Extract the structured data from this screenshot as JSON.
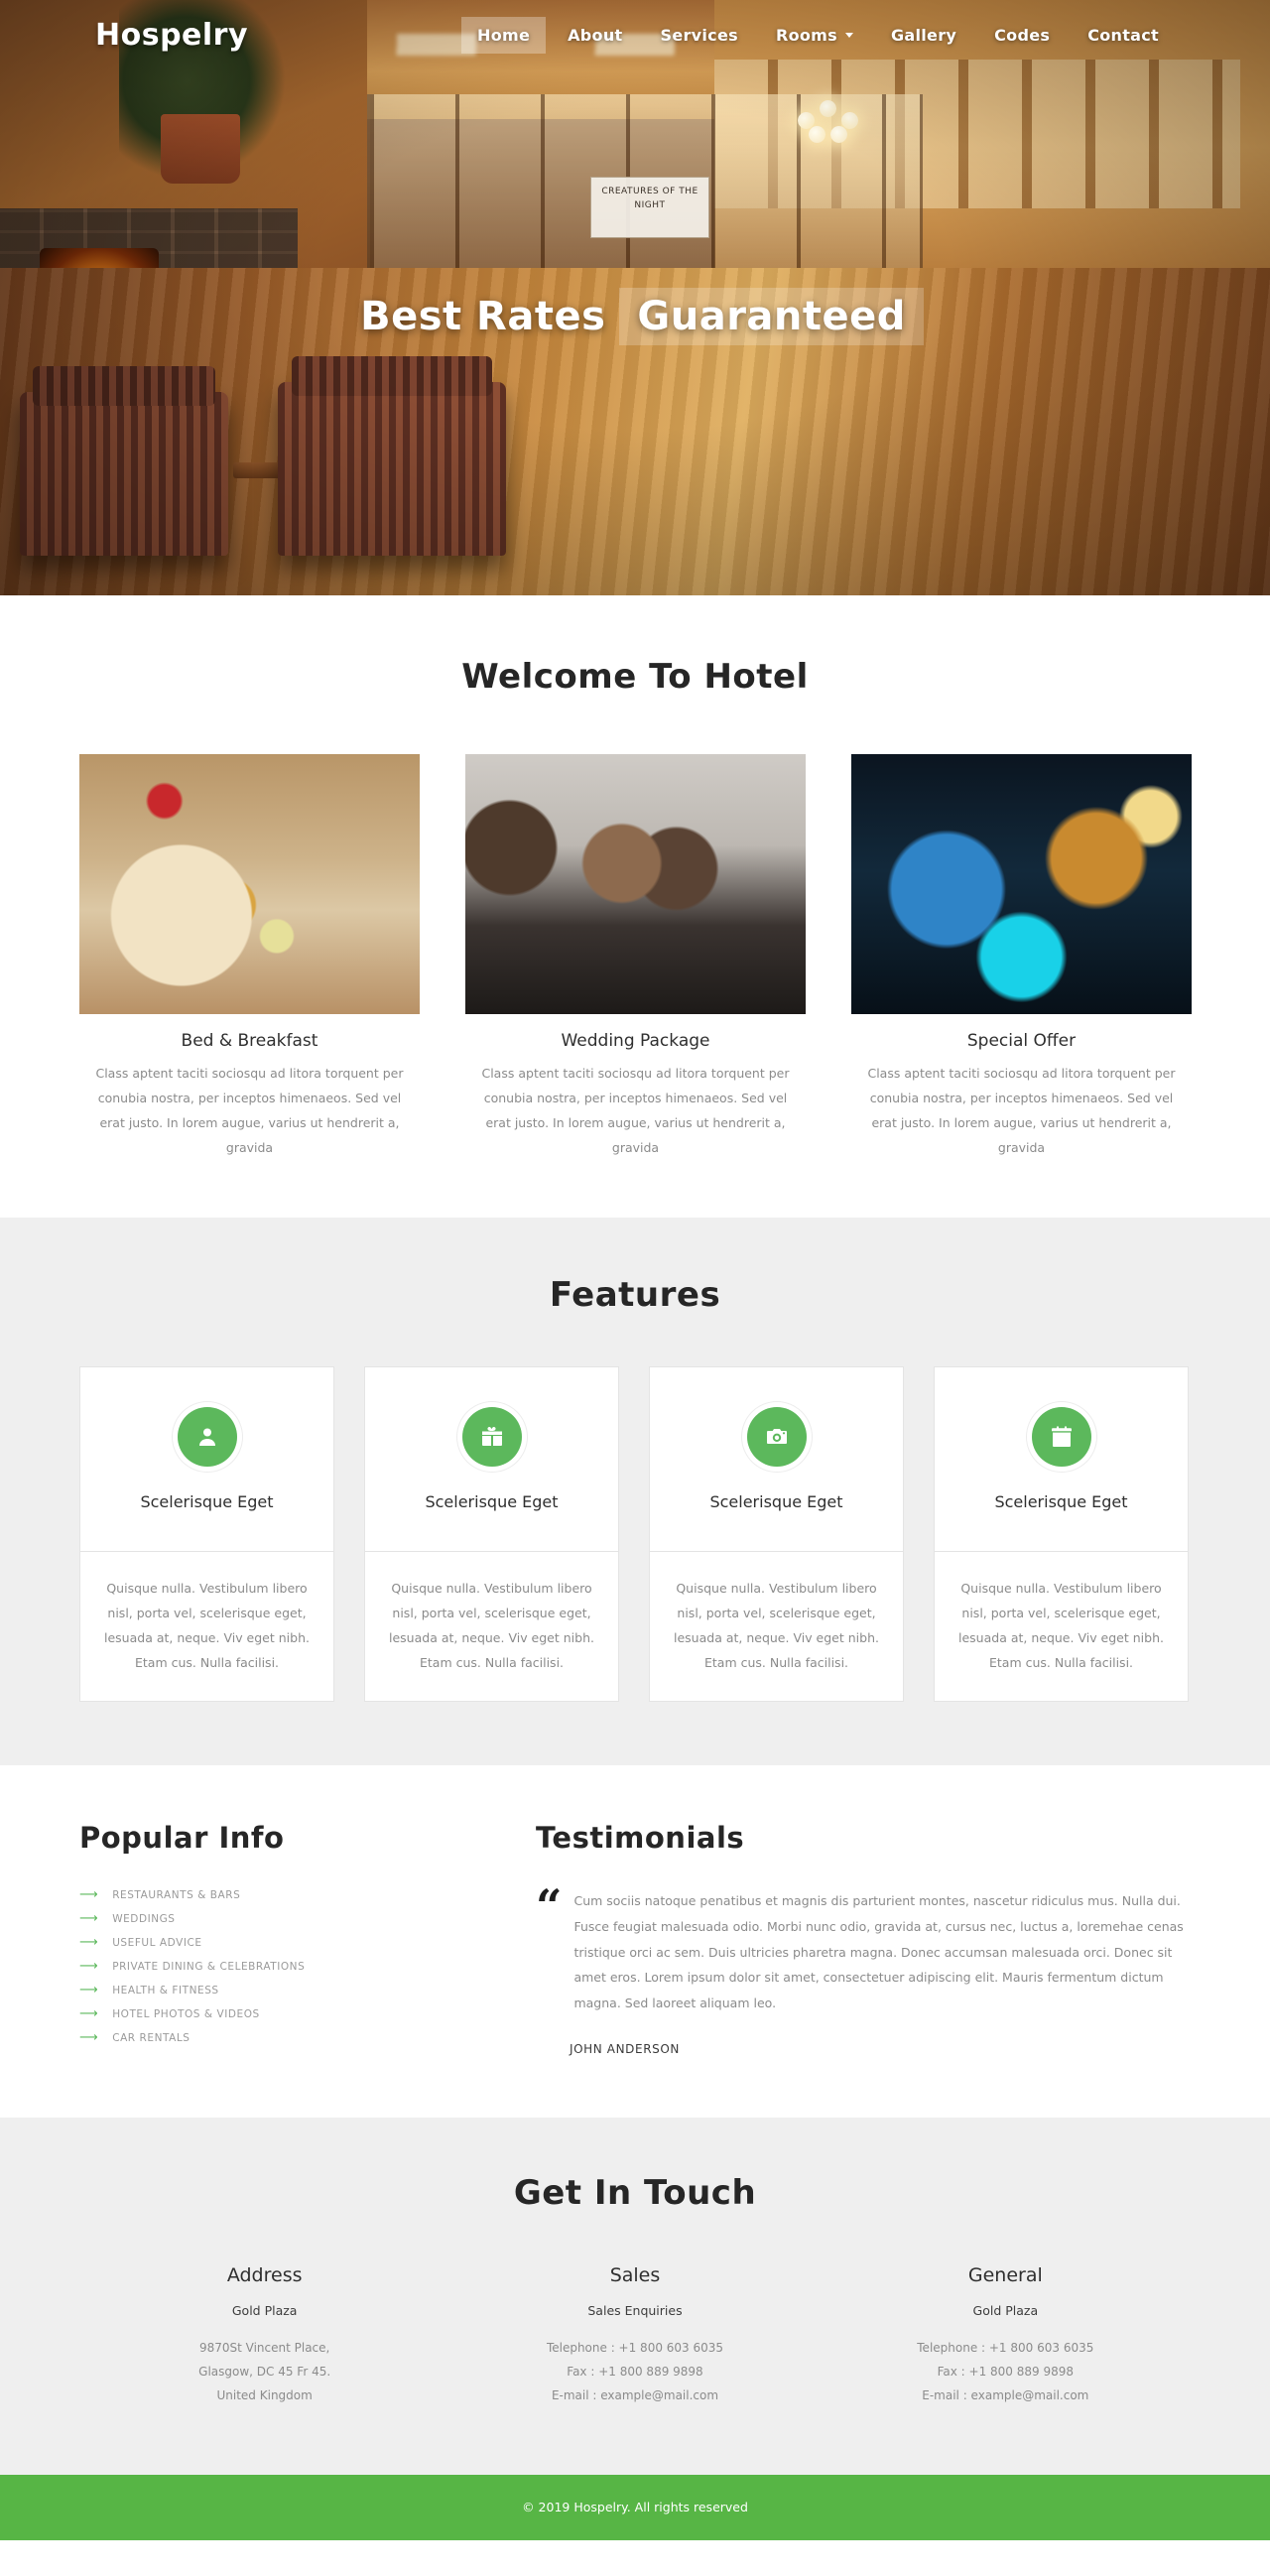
{
  "site": {
    "logo": "Hospelry"
  },
  "nav": {
    "items": [
      {
        "label": "Home",
        "active": true,
        "caret": false
      },
      {
        "label": "About",
        "active": false,
        "caret": false
      },
      {
        "label": "Services",
        "active": false,
        "caret": false
      },
      {
        "label": "Rooms",
        "active": false,
        "caret": true
      },
      {
        "label": "Gallery",
        "active": false,
        "caret": false
      },
      {
        "label": "Codes",
        "active": false,
        "caret": false
      },
      {
        "label": "Contact",
        "active": false,
        "caret": false
      }
    ]
  },
  "hero": {
    "caption_part1": "Best Rates",
    "caption_part2": "Guaranteed",
    "sign_text": "CREATURES OF THE NIGHT"
  },
  "welcome": {
    "title": "Welcome To Hotel",
    "cards": [
      {
        "title": "Bed & Breakfast",
        "text": "Class aptent taciti sociosqu ad litora torquent per conubia nostra, per inceptos himenaeos. Sed vel erat justo. In lorem augue, varius ut hendrerit a, gravida",
        "image": "breakfast-photo"
      },
      {
        "title": "Wedding Package",
        "text": "Class aptent taciti sociosqu ad litora torquent per conubia nostra, per inceptos himenaeos. Sed vel erat justo. In lorem augue, varius ut hendrerit a, gravida",
        "image": "wedding-photo"
      },
      {
        "title": "Special Offer",
        "text": "Class aptent taciti sociosqu ad litora torquent per conubia nostra, per inceptos himenaeos. Sed vel erat justo. In lorem augue, varius ut hendrerit a, gravida",
        "image": "concert-photo"
      }
    ]
  },
  "features": {
    "title": "Features",
    "items": [
      {
        "icon": "user-icon",
        "label": "Scelerisque Eget",
        "text": "Quisque nulla. Vestibulum libero nisl, porta vel, scelerisque eget, lesuada at, neque. Viv eget nibh. Etam cus. Nulla facilisi."
      },
      {
        "icon": "gift-icon",
        "label": "Scelerisque Eget",
        "text": "Quisque nulla. Vestibulum libero nisl, porta vel, scelerisque eget, lesuada at, neque. Viv eget nibh. Etam cus. Nulla facilisi."
      },
      {
        "icon": "camera-icon",
        "label": "Scelerisque Eget",
        "text": "Quisque nulla. Vestibulum libero nisl, porta vel, scelerisque eget, lesuada at, neque. Viv eget nibh. Etam cus. Nulla facilisi."
      },
      {
        "icon": "calendar-icon",
        "label": "Scelerisque Eget",
        "text": "Quisque nulla. Vestibulum libero nisl, porta vel, scelerisque eget, lesuada at, neque. Viv eget nibh. Etam cus. Nulla facilisi."
      }
    ]
  },
  "popular_info": {
    "title": "Popular Info",
    "items": [
      "RESTAURANTS & BARS",
      "WEDDINGS",
      "USEFUL ADVICE",
      "PRIVATE DINING & CELEBRATIONS",
      "HEALTH & FITNESS",
      "HOTEL PHOTOS & VIDEOS",
      "CAR RENTALS"
    ]
  },
  "testimonials": {
    "title": "Testimonials",
    "quote_mark": "“",
    "quote": "Cum sociis natoque penatibus et magnis dis parturient montes, nascetur ridiculus mus. Nulla dui. Fusce feugiat malesuada odio. Morbi nunc odio, gravida at, cursus nec, luctus a, loremehae cenas tristique orci ac sem. Duis ultricies pharetra magna. Donec accumsan malesuada orci. Donec sit amet eros. Lorem ipsum dolor sit amet, consectetuer adipiscing elit. Mauris fermentum dictum magna. Sed laoreet aliquam leo.",
    "author": "JOHN ANDERSON"
  },
  "contact": {
    "title": "Get In Touch",
    "columns": [
      {
        "heading": "Address",
        "sub": "Gold Plaza",
        "lines": [
          "9870St Vincent Place,",
          "Glasgow, DC 45 Fr 45.",
          "United Kingdom"
        ]
      },
      {
        "heading": "Sales",
        "sub": "Sales Enquiries",
        "lines": [
          "Telephone : +1 800 603 6035",
          "Fax : +1 800 889 9898",
          "E-mail : example@mail.com"
        ]
      },
      {
        "heading": "General",
        "sub": "Gold Plaza",
        "lines": [
          "Telephone : +1 800 603 6035",
          "Fax : +1 800 889 9898",
          "E-mail : example@mail.com"
        ]
      }
    ]
  },
  "footer": {
    "copyright": "© 2019 Hospelry. All rights reserved"
  },
  "colors": {
    "accent_green": "#5cb85c",
    "footer_green": "#57b545",
    "section_gray": "#efefef"
  }
}
